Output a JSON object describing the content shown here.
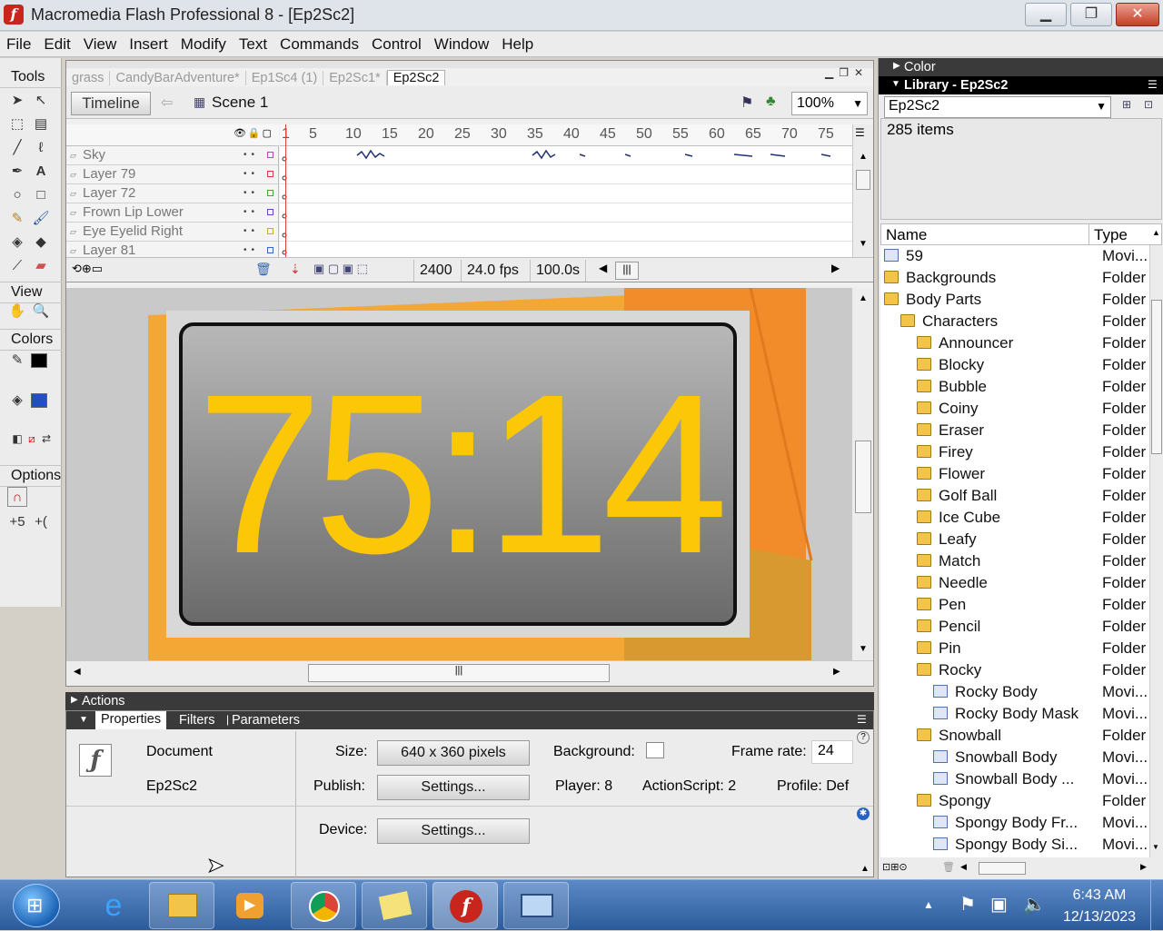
{
  "window": {
    "title": "Macromedia Flash Professional 8 - [Ep2Sc2]"
  },
  "menu": [
    "File",
    "Edit",
    "View",
    "Insert",
    "Modify",
    "Text",
    "Commands",
    "Control",
    "Window",
    "Help"
  ],
  "tools": {
    "tools_label": "Tools",
    "view_label": "View",
    "colors_label": "Colors",
    "options_label": "Options"
  },
  "doc_tabs": [
    "grass",
    "CandyBarAdventure*",
    "Ep1Sc4 (1)",
    "Ep2Sc1*",
    "Ep2Sc2"
  ],
  "editbar": {
    "timeline_label": "Timeline",
    "scene_label": "Scene 1",
    "zoom": "100%"
  },
  "timeline": {
    "ruler": [
      "1",
      "5",
      "10",
      "15",
      "20",
      "25",
      "30",
      "35",
      "40",
      "45",
      "50",
      "55",
      "60",
      "65",
      "70",
      "75"
    ],
    "layers": [
      {
        "name": "Sky",
        "color": "#c040c0"
      },
      {
        "name": "Layer 79",
        "color": "#d04040"
      },
      {
        "name": "Layer 72",
        "color": "#30b030"
      },
      {
        "name": "Frown Lip Lower",
        "color": "#7040c0"
      },
      {
        "name": "Eye Eyelid Right",
        "color": "#c0b020"
      },
      {
        "name": "Layer 81",
        "color": "#4060c0"
      }
    ],
    "current_frame": "2400",
    "frame_rate": "24.0 fps",
    "elapsed": "100.0s"
  },
  "stage": {
    "counter_text": "75:14"
  },
  "panels": {
    "actions_label": "Actions",
    "props_tabs": [
      "Properties",
      "Filters",
      "Parameters"
    ]
  },
  "properties": {
    "doc_label": "Document",
    "doc_name": "Ep2Sc2",
    "size_label": "Size:",
    "size_value": "640 x 360 pixels",
    "background_label": "Background:",
    "frame_rate_label": "Frame rate:",
    "frame_rate_value": "24",
    "publish_label": "Publish:",
    "settings_label": "Settings...",
    "player_text": "Player:  8",
    "actionscript_text": "ActionScript:  2",
    "profile_text": "Profile:  Def",
    "device_label": "Device:",
    "device_settings": "Settings..."
  },
  "right_panel": {
    "color_label": "Color",
    "library_title": "Library - Ep2Sc2",
    "library_select": "Ep2Sc2",
    "item_count": "285 items",
    "col_name": "Name",
    "col_type": "Type",
    "items": [
      {
        "name": "59",
        "type": "Movi...",
        "kind": "movie",
        "indent": 0
      },
      {
        "name": "Backgrounds",
        "type": "Folder",
        "kind": "folder",
        "indent": 0
      },
      {
        "name": "Body Parts",
        "type": "Folder",
        "kind": "folder",
        "indent": 0
      },
      {
        "name": "Characters",
        "type": "Folder",
        "kind": "folder",
        "indent": 1
      },
      {
        "name": "Announcer",
        "type": "Folder",
        "kind": "folder",
        "indent": 2
      },
      {
        "name": "Blocky",
        "type": "Folder",
        "kind": "folder",
        "indent": 2
      },
      {
        "name": "Bubble",
        "type": "Folder",
        "kind": "folder",
        "indent": 2
      },
      {
        "name": "Coiny",
        "type": "Folder",
        "kind": "folder",
        "indent": 2
      },
      {
        "name": "Eraser",
        "type": "Folder",
        "kind": "folder",
        "indent": 2
      },
      {
        "name": "Firey",
        "type": "Folder",
        "kind": "folder",
        "indent": 2
      },
      {
        "name": "Flower",
        "type": "Folder",
        "kind": "folder",
        "indent": 2
      },
      {
        "name": "Golf Ball",
        "type": "Folder",
        "kind": "folder",
        "indent": 2
      },
      {
        "name": "Ice Cube",
        "type": "Folder",
        "kind": "folder",
        "indent": 2
      },
      {
        "name": "Leafy",
        "type": "Folder",
        "kind": "folder",
        "indent": 2
      },
      {
        "name": "Match",
        "type": "Folder",
        "kind": "folder",
        "indent": 2
      },
      {
        "name": "Needle",
        "type": "Folder",
        "kind": "folder",
        "indent": 2
      },
      {
        "name": "Pen",
        "type": "Folder",
        "kind": "folder",
        "indent": 2
      },
      {
        "name": "Pencil",
        "type": "Folder",
        "kind": "folder",
        "indent": 2
      },
      {
        "name": "Pin",
        "type": "Folder",
        "kind": "folder",
        "indent": 2
      },
      {
        "name": "Rocky",
        "type": "Folder",
        "kind": "folder",
        "indent": 2
      },
      {
        "name": "Rocky Body",
        "type": "Movi...",
        "kind": "movie",
        "indent": 3
      },
      {
        "name": "Rocky Body Mask",
        "type": "Movi...",
        "kind": "movie",
        "indent": 3
      },
      {
        "name": "Snowball",
        "type": "Folder",
        "kind": "folder",
        "indent": 2
      },
      {
        "name": "Snowball Body",
        "type": "Movi...",
        "kind": "movie",
        "indent": 3
      },
      {
        "name": "Snowball Body ...",
        "type": "Movi...",
        "kind": "movie",
        "indent": 3
      },
      {
        "name": "Spongy",
        "type": "Folder",
        "kind": "folder",
        "indent": 2
      },
      {
        "name": "Spongy Body Fr...",
        "type": "Movi...",
        "kind": "movie",
        "indent": 3
      },
      {
        "name": "Spongy Body Si...",
        "type": "Movi...",
        "kind": "movie",
        "indent": 3
      }
    ]
  },
  "taskbar": {
    "time": "6:43 AM",
    "date": "12/13/2023"
  }
}
